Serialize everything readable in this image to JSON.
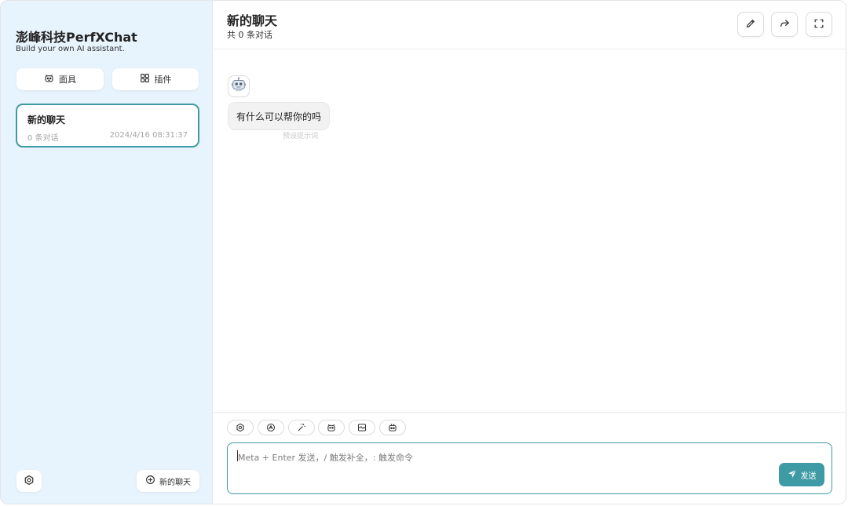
{
  "sidebar": {
    "title": "澎峰科技PerfXChat",
    "subtitle": "Build your own AI assistant.",
    "masks_button": {
      "label": "面具",
      "icon": "mask-icon"
    },
    "plugins_button": {
      "label": "插件",
      "icon": "grid-icon"
    },
    "chat_list": [
      {
        "title": "新的聊天",
        "count": "0 条对话",
        "time": "2024/4/16 08:31:37",
        "selected": true
      }
    ],
    "settings_button": {
      "icon": "settings-icon"
    },
    "new_chat_button": {
      "label": "新的聊天",
      "icon": "plus-circle-icon"
    }
  },
  "chat": {
    "title": "新的聊天",
    "subtitle": "共 0 条对话",
    "header_buttons": [
      "edit-icon",
      "share-icon",
      "fullscreen-icon"
    ],
    "messages": [
      {
        "role": "assistant",
        "avatar": "robot-icon",
        "text": "有什么可以帮你的吗",
        "hint": "预设提示词"
      }
    ]
  },
  "input": {
    "toolbar": [
      "settings-icon",
      "theme-icon",
      "prompt-wand-icon",
      "mask-icon",
      "clear-context-icon",
      "robot-icon"
    ],
    "placeholder": "Meta + Enter 发送，/ 触发补全，: 触发命令",
    "send_label": "发送",
    "send_icon": "send-icon"
  },
  "colors": {
    "accent": "#3e9aa5",
    "sidebar_bg": "#e7f3fd",
    "bubble_bg": "#f2f2f2"
  }
}
